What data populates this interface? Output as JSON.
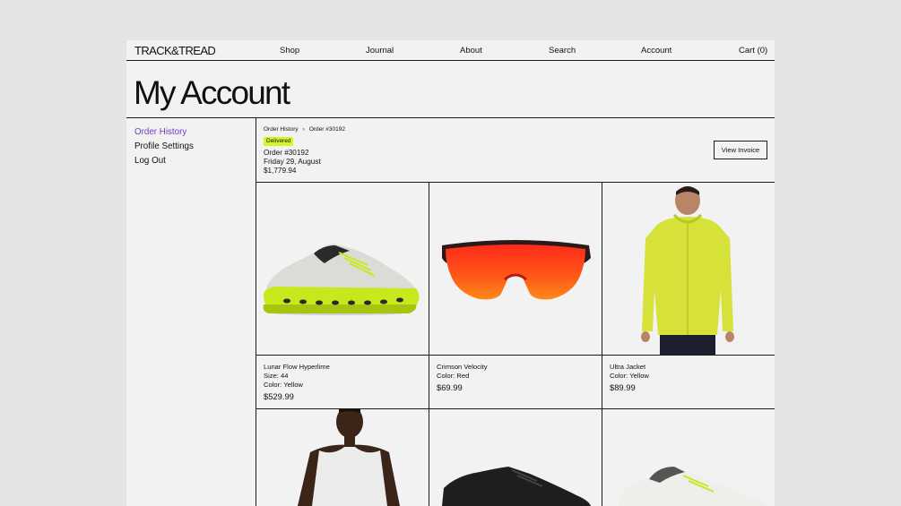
{
  "brand": {
    "logo": "TRACK&TREAD"
  },
  "nav": {
    "shop": "Shop",
    "journal": "Journal",
    "about": "About",
    "search": "Search",
    "account": "Account",
    "cart": "Cart (0)"
  },
  "page": {
    "title": "My Account"
  },
  "sidebar": {
    "items": [
      {
        "label": "Order History",
        "active": true
      },
      {
        "label": "Profile Settings",
        "active": false
      },
      {
        "label": "Log Out",
        "active": false
      }
    ]
  },
  "order": {
    "breadcrumb": [
      "Order History",
      "Order #30192"
    ],
    "breadcrumb_separator": "›",
    "status": "Delivered",
    "number": "Order #30192",
    "date": "Friday 29, August",
    "total": "$1,779.94",
    "invoice_label": "View Invoice"
  },
  "products": [
    {
      "name": "Lunar Flow Hyperlime",
      "size": "Size: 44",
      "color": "Color: Yellow",
      "price": "$529.99",
      "image": "running-shoe-white-lime"
    },
    {
      "name": "Crimson Velocity",
      "size": "",
      "color": "Color: Red",
      "price": "$69.99",
      "image": "sport-sunglasses-red"
    },
    {
      "name": "Ultra Jacket",
      "size": "",
      "color": "Color: Yellow",
      "price": "$89.99",
      "image": "man-yellow-jacket"
    },
    {
      "image": "man-white-tank-top"
    },
    {
      "image": "black-running-shoe"
    },
    {
      "image": "white-running-shoe"
    }
  ],
  "colors": {
    "background": "#e4e4e4",
    "panel": "#f2f2f2",
    "accent": "#6a3ec8",
    "badge": "#d8f42a"
  }
}
